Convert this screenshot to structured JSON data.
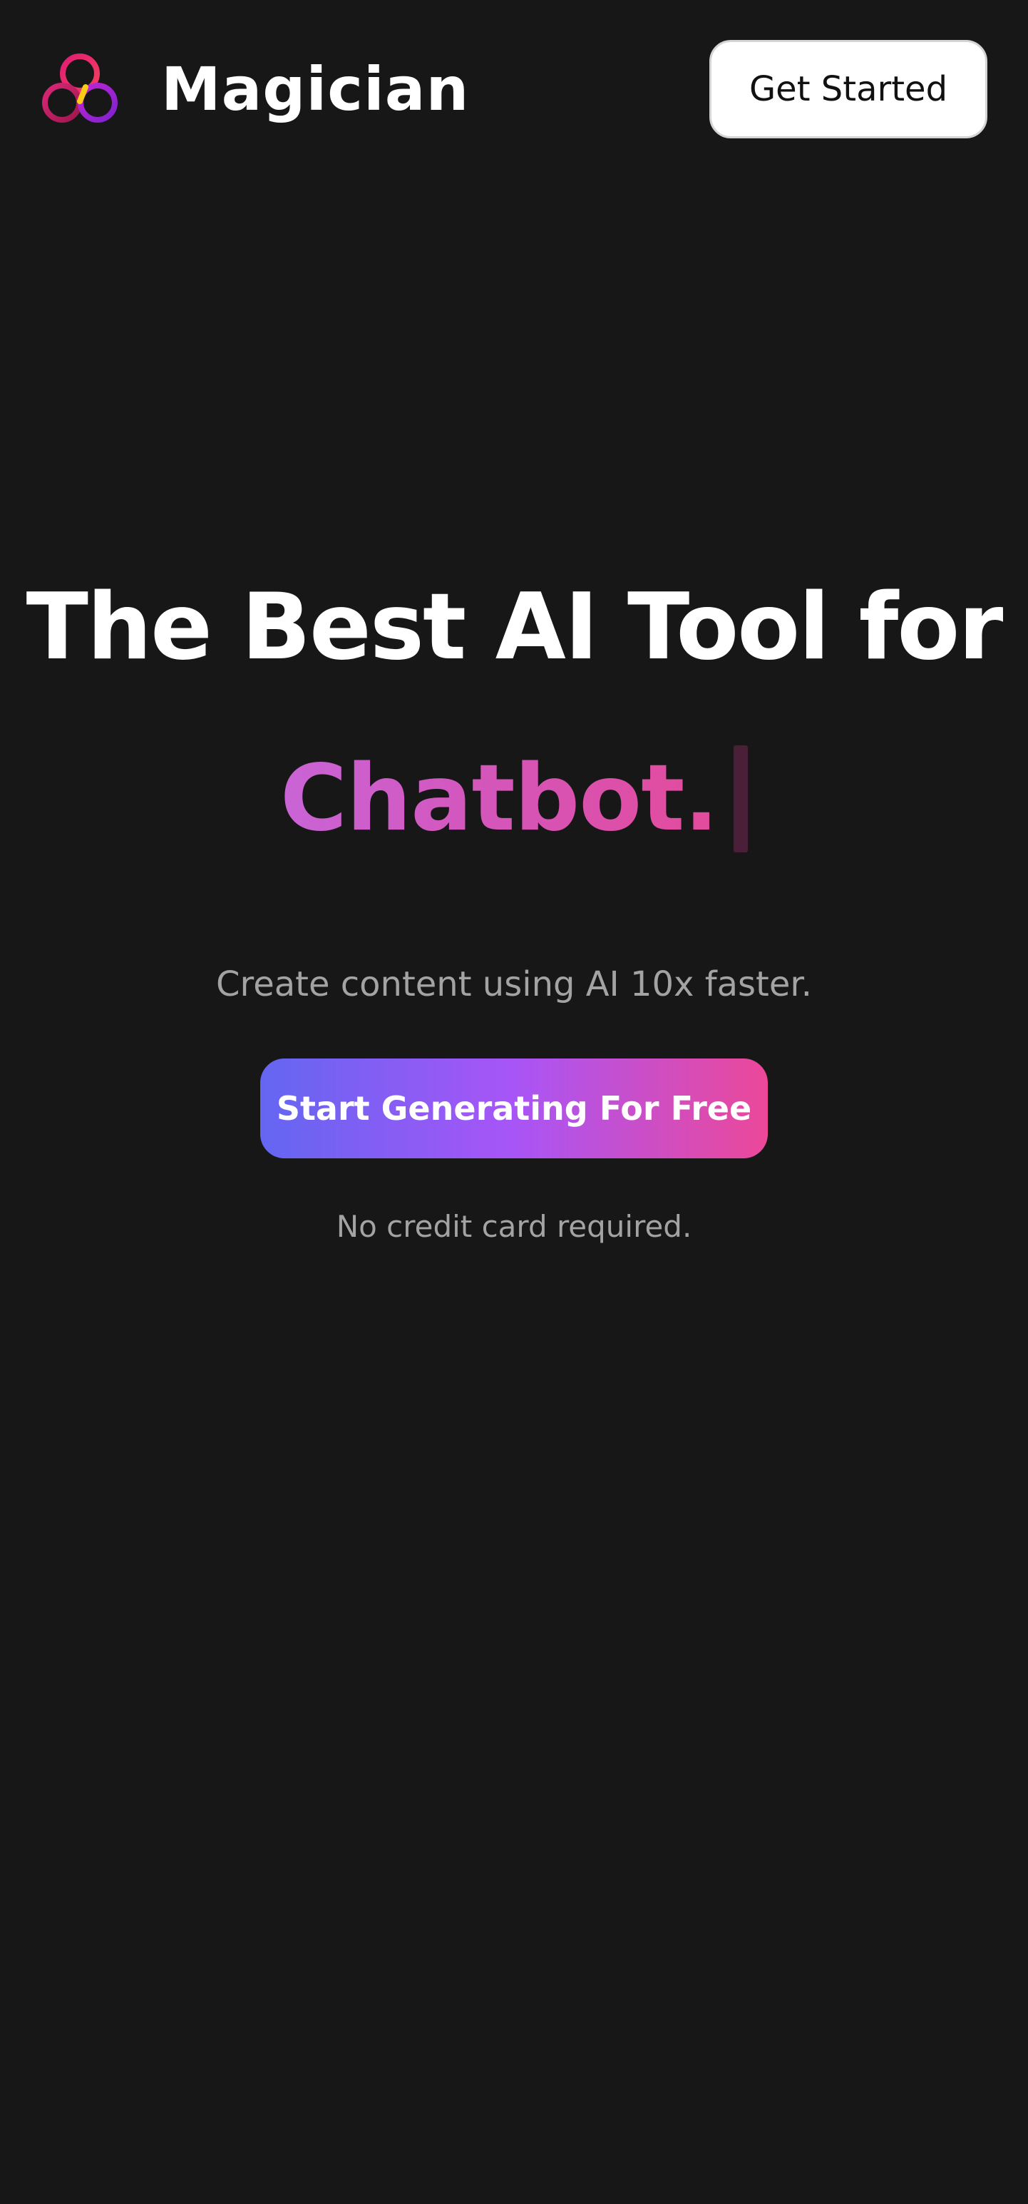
{
  "header": {
    "brand_name": "Magician",
    "get_started_label": "Get Started"
  },
  "hero": {
    "headline": "The Best AI Tool for",
    "typed_word": "Chatbot.",
    "subtitle": "Create content using AI 10x faster.",
    "cta_label": "Start Generating For Free",
    "note": "No credit card required."
  },
  "colors": {
    "background": "#171717",
    "cta_gradient_start": "#6366f1",
    "cta_gradient_mid": "#a855f7",
    "cta_gradient_end": "#ec4899",
    "typed_word_gradient_start": "#c964d6",
    "typed_word_gradient_end": "#e34b9b",
    "muted_text": "#a3a3a3"
  },
  "icons": {
    "logo": "three-interlocking-rings-logo"
  }
}
